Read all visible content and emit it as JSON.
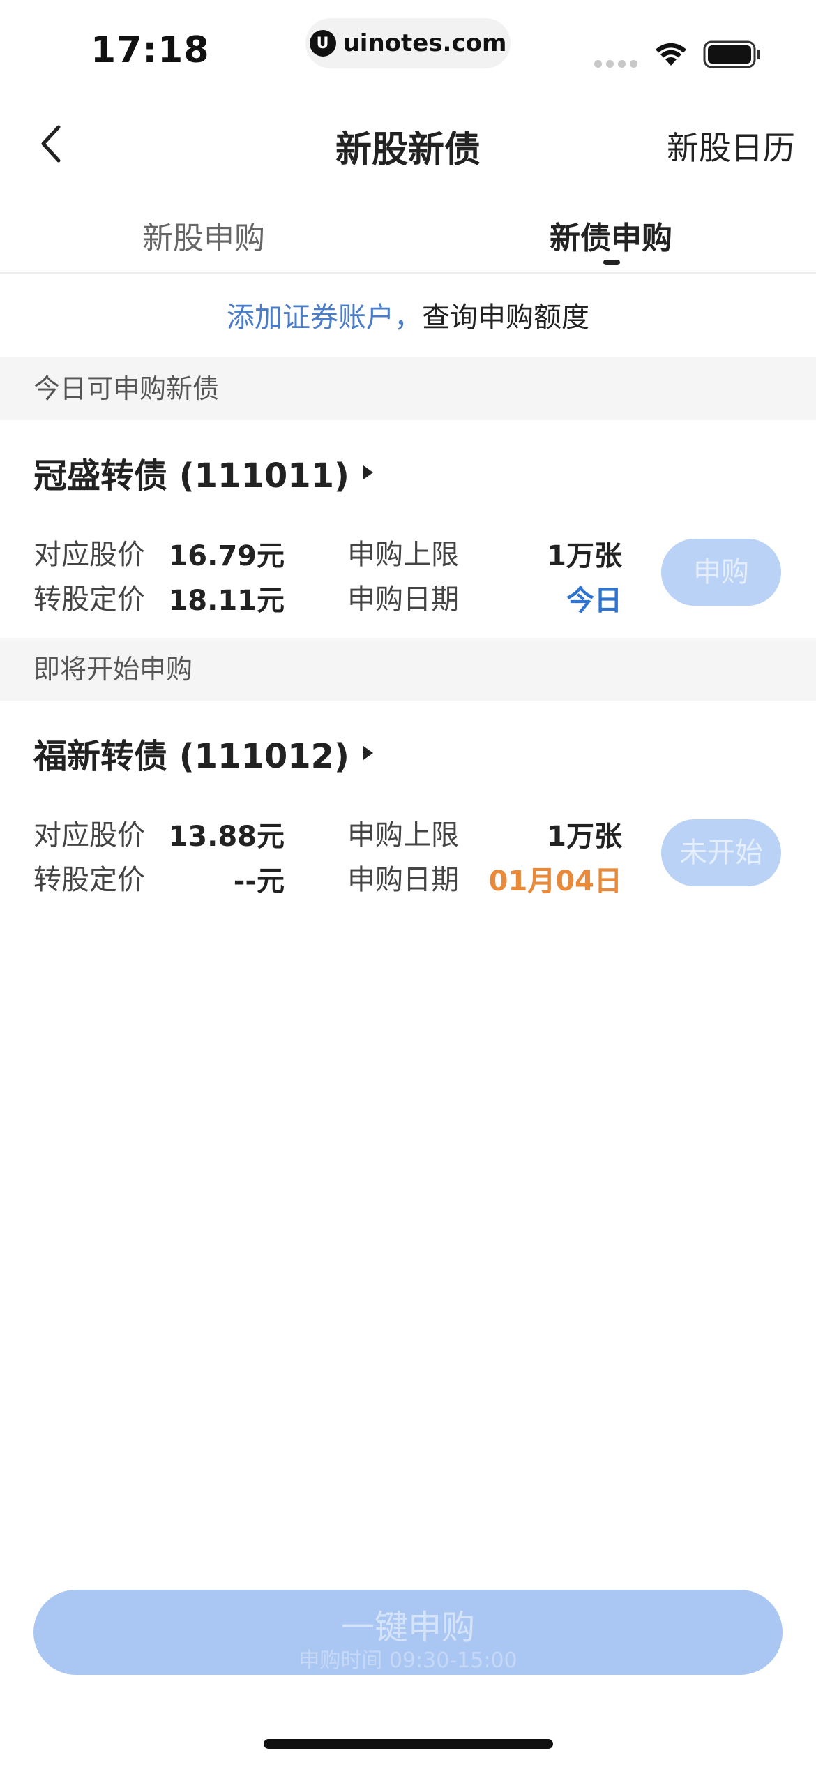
{
  "status_bar": {
    "time": "17:18",
    "url": "uinotes.com",
    "icons": [
      "signal-icon",
      "wifi-icon",
      "battery-icon"
    ]
  },
  "nav": {
    "back_icon": "chevron-left-icon",
    "title": "新股新债",
    "right_link": "新股日历"
  },
  "tabs": [
    {
      "label": "新股申购",
      "active": false
    },
    {
      "label": "新债申购",
      "active": true
    }
  ],
  "account_prompt": {
    "link_text": "添加证券账户，",
    "text": "查询申购额度"
  },
  "sections": [
    {
      "header": "今日可申购新债",
      "bond": {
        "name": "冠盛转债 (111011)",
        "stock_price_label": "对应股价",
        "stock_price": "16.79元",
        "conversion_price_label": "转股定价",
        "conversion_price": "18.11元",
        "limit_label": "申购上限",
        "limit": "1万张",
        "date_label": "申购日期",
        "date": "今日",
        "button": "申购"
      }
    },
    {
      "header": "即将开始申购",
      "bond": {
        "name": "福新转债 (111012)",
        "stock_price_label": "对应股价",
        "stock_price": "13.88元",
        "conversion_price_label": "转股定价",
        "conversion_price": "--元",
        "limit_label": "申购上限",
        "limit": "1万张",
        "date_label": "申购日期",
        "date": "01月04日",
        "button": "未开始"
      }
    }
  ],
  "bottom_button": {
    "label": "一键申购",
    "subtitle": "申购时间 09:30-15:00"
  },
  "colors": {
    "link_blue": "#4a7cc7",
    "today_blue": "#2f74d0",
    "date_orange": "#e88a3a",
    "disabled_button": "#b9d2f5"
  }
}
